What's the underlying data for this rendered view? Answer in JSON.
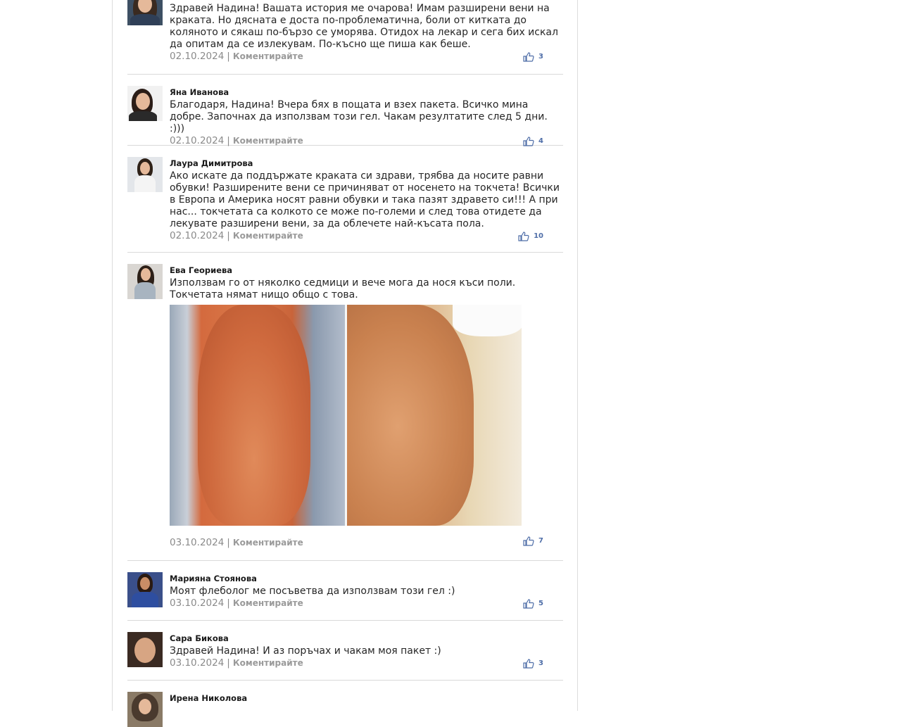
{
  "colors": {
    "accent": "#4f6ea8",
    "border": "#d9d9d9",
    "muted": "#8a8a8a"
  },
  "comments": [
    {
      "name": "",
      "text": "Здравей Надина! Вашата история ме очарова! Имам разширени вени на краката. Но дясната е доста по-проблематична, боли от китката до коляното и сякаш по-бързо се уморява. Отидох на лекар и сега бих искал да опитам да се излекувам. По-късно ще пиша как беше.",
      "date": "02.10.2024",
      "reply": "Коментирайте",
      "likes": "3",
      "icon": "thumbs-up-icon"
    },
    {
      "name": "Яна Иванова",
      "text": "Благодаря, Надина! Вчера бях в пощата и взех пакета. Всичко мина добре. Започнах да използвам този гел. Чакам резултатите след 5 дни. :)))",
      "date": "02.10.2024",
      "reply": "Коментирайте",
      "likes": "4",
      "icon": "thumbs-up-icon"
    },
    {
      "name": "Лаура Димитрова",
      "text": "Ако искате да поддържате краката си здрави, трябва да носите равни обувки! Разширените вени се причиняват от носенето на токчета! Всички в Европа и Америка носят равни обувки и така пазят здравето си!!! А при нас... токчетата са колкото се може по-големи и след това отидете да лекувате разширени вени, за да облечете най-късата пола.",
      "date": "02.10.2024",
      "reply": "Коментирайте",
      "likes": "10",
      "icon": "thumbs-up-icon"
    },
    {
      "name": "Ева Геориева",
      "text": "Използвам го от няколко седмици и вече мога да нося къси поли. Токчетата нямат нищо общо с това.",
      "date": "03.10.2024",
      "reply": "Коментирайте",
      "likes": "7",
      "icon": "thumbs-up-icon"
    },
    {
      "name": "Марияна Стоянова",
      "text": "Моят флеболог ме посъветва да използвам този гел :)",
      "date": "03.10.2024",
      "reply": "Коментирайте",
      "likes": "5",
      "icon": "thumbs-up-icon"
    },
    {
      "name": "Сара Бикова",
      "text": "Здравей Надина! И аз поръчах и чакам моя пакет :)",
      "date": "03.10.2024",
      "reply": "Коментирайте",
      "likes": "3",
      "icon": "thumbs-up-icon"
    },
    {
      "name": "Ирена Николова",
      "text": "",
      "date": "",
      "reply": "",
      "likes": "",
      "icon": "thumbs-up-icon"
    }
  ]
}
